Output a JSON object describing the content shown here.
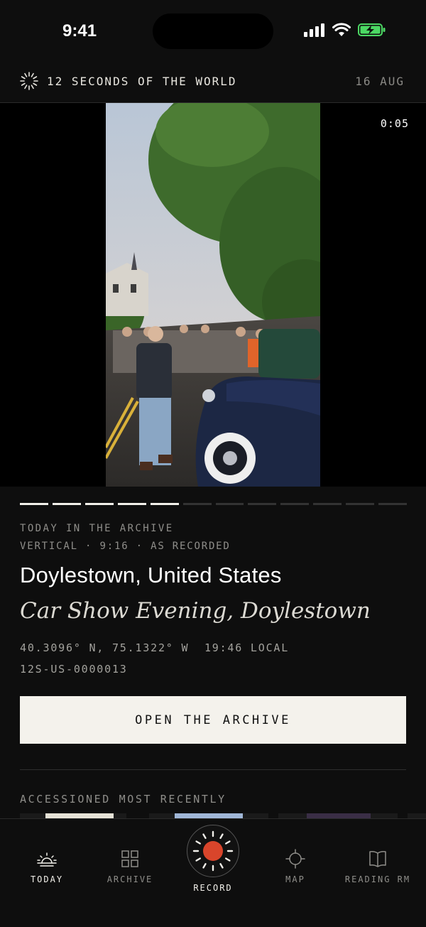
{
  "status_bar": {
    "time": "9:41"
  },
  "header": {
    "title": "12 SECONDS OF THE WORLD",
    "date": "16 AUG"
  },
  "video": {
    "timer": "0:05"
  },
  "progress": {
    "total": 12,
    "filled": 5
  },
  "clip": {
    "eyebrow": "TODAY IN THE ARCHIVE",
    "meta": "VERTICAL · 9:16 · AS RECORDED",
    "place": "Doylestown, United States",
    "subtitle": "Car Show Evening, Doylestown",
    "coords": "40.3096° N, 75.1322° W  19:46 LOCAL",
    "code": "12S-US-0000013"
  },
  "cta": {
    "label": "OPEN THE ARCHIVE"
  },
  "recent": {
    "label": "ACCESSIONED MOST RECENTLY"
  },
  "tabs": [
    {
      "label": "TODAY",
      "icon": "sunrise-icon",
      "active": true
    },
    {
      "label": "ARCHIVE",
      "icon": "grid-icon",
      "active": false
    },
    {
      "label": "RECORD",
      "icon": "record-icon",
      "active": false
    },
    {
      "label": "MAP",
      "icon": "crosshair-icon",
      "active": false
    },
    {
      "label": "READING RM",
      "icon": "book-icon",
      "active": false
    }
  ],
  "colors": {
    "accent": "#d9452b",
    "background": "#0e0e0e",
    "button_bg": "#f4f2ec",
    "battery": "#4cd964"
  }
}
